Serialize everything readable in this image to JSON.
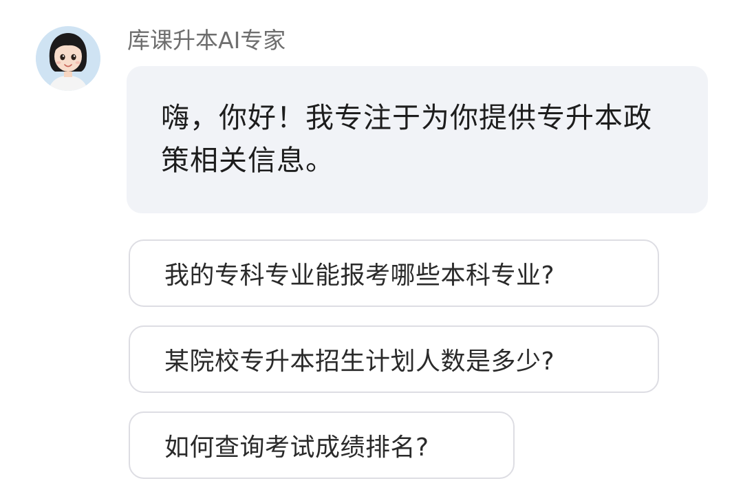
{
  "chat": {
    "sender": {
      "name": "库课升本AI专家",
      "avatar_icon": "cartoon-girl-avatar"
    },
    "message": {
      "text": "嗨，你好！我专注于为你提供专升本政策相关信息。"
    },
    "suggestions": [
      {
        "label": "我的专科专业能报考哪些本科专业?"
      },
      {
        "label": "某院校专升本招生计划人数是多少?"
      },
      {
        "label": "如何查询考试成绩排名?"
      }
    ]
  },
  "colors": {
    "bubble_bg": "#f1f3f7",
    "suggestion_border": "#dddde3",
    "name_text": "#6e6e6e",
    "message_text": "#1d1d1d"
  }
}
